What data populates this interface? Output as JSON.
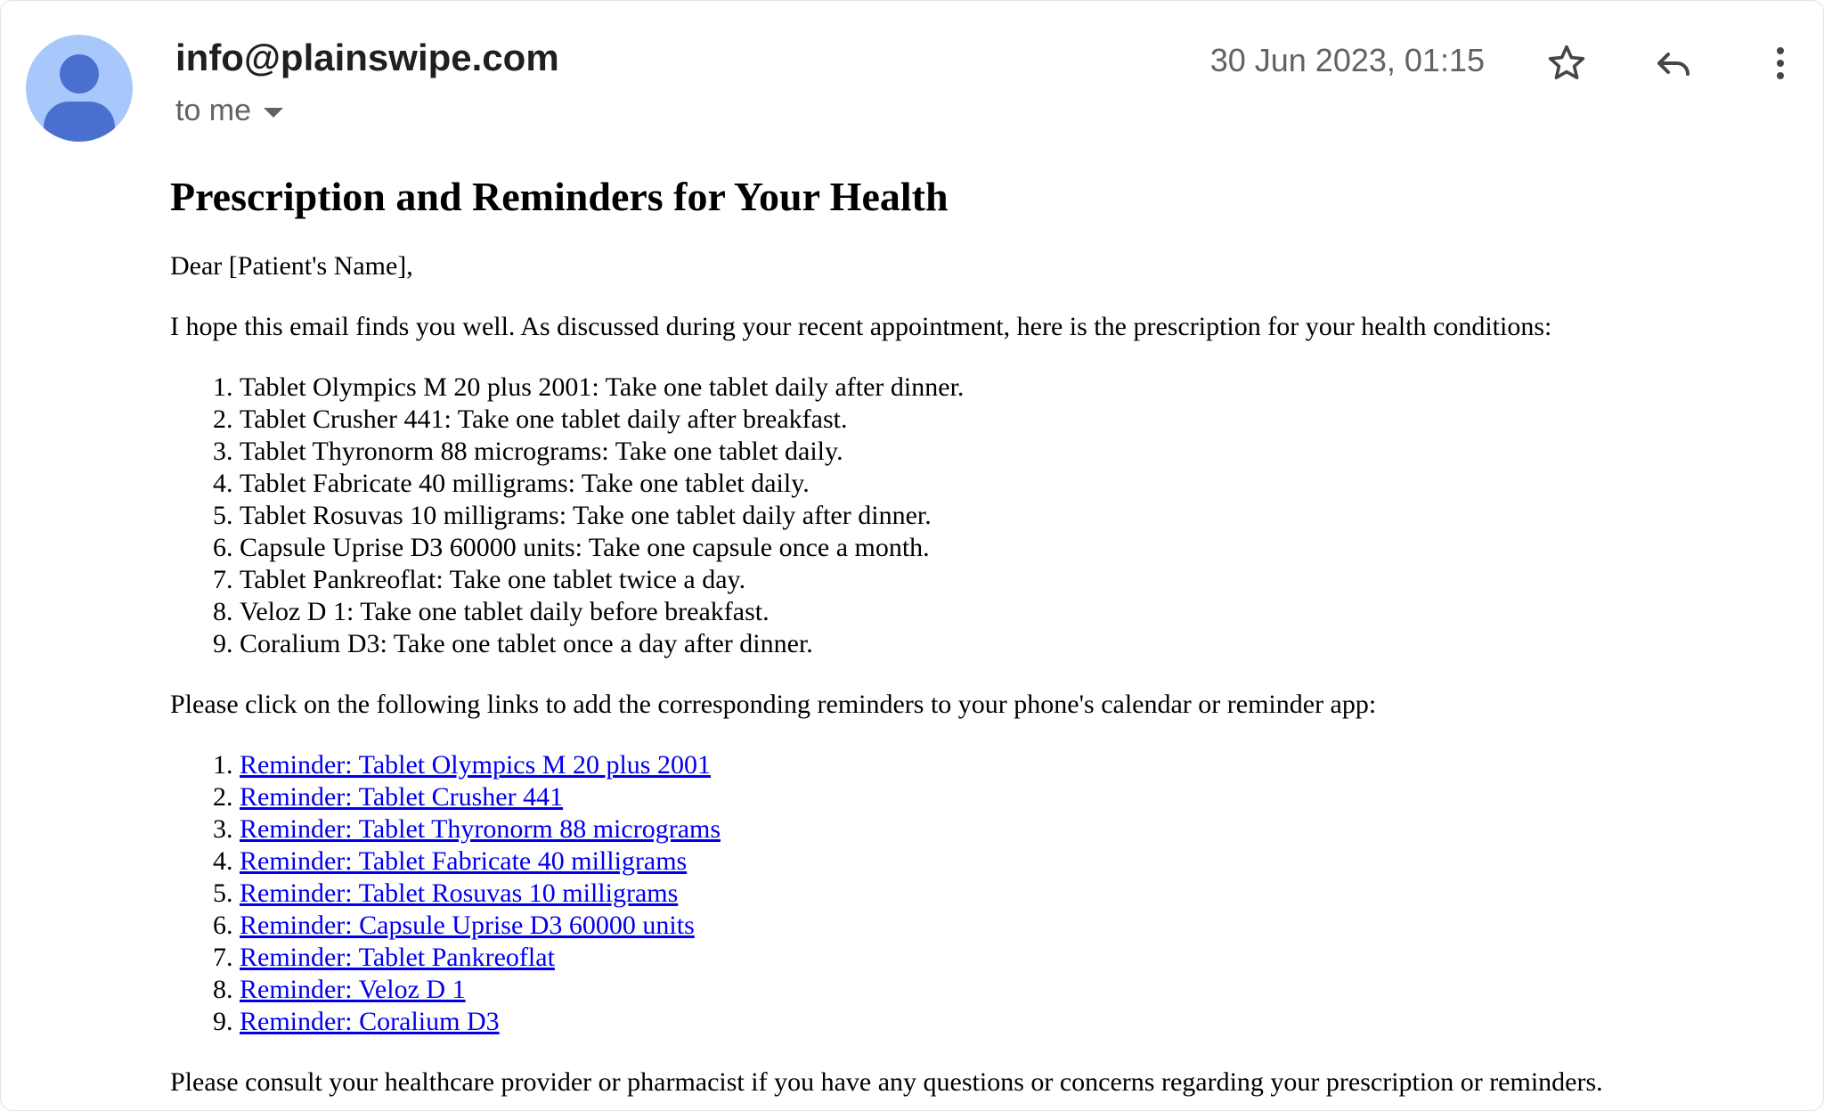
{
  "email": {
    "sender": "info@plainswipe.com",
    "recipient": "to me",
    "date": "30 Jun 2023, 01:15",
    "subject": "Prescription and Reminders for Your Health",
    "greeting": "Dear [Patient's Name],",
    "intro": "I hope this email finds you well. As discussed during your recent appointment, here is the prescription for your health conditions:",
    "prescriptions": [
      "Tablet Olympics M 20 plus 2001: Take one tablet daily after dinner.",
      "Tablet Crusher 441: Take one tablet daily after breakfast.",
      "Tablet Thyronorm 88 micrograms: Take one tablet daily.",
      "Tablet Fabricate 40 milligrams: Take one tablet daily.",
      "Tablet Rosuvas 10 milligrams: Take one tablet daily after dinner.",
      "Capsule Uprise D3 60000 units: Take one capsule once a month.",
      "Tablet Pankreoflat: Take one tablet twice a day.",
      "Veloz D 1: Take one tablet daily before breakfast.",
      "Coralium D3: Take one tablet once a day after dinner."
    ],
    "links_intro": "Please click on the following links to add the corresponding reminders to your phone's calendar or reminder app:",
    "reminders": [
      "Reminder: Tablet Olympics M 20 plus 2001",
      "Reminder: Tablet Crusher 441",
      "Reminder: Tablet Thyronorm 88 micrograms",
      "Reminder: Tablet Fabricate 40 milligrams",
      "Reminder: Tablet Rosuvas 10 milligrams",
      "Reminder: Capsule Uprise D3 60000 units",
      "Reminder: Tablet Pankreoflat",
      "Reminder: Veloz D 1",
      "Reminder: Coralium D3"
    ],
    "closing": "Please consult your healthcare provider or pharmacist if you have any questions or concerns regarding your prescription or reminders."
  },
  "icons": {
    "avatar": "person-avatar-icon",
    "recipient_toggle": "caret-down-icon",
    "star": "star-outline-icon",
    "reply": "reply-arrow-icon",
    "more": "more-vertical-icon"
  },
  "colors": {
    "avatar_bg": "#a8c7fa",
    "avatar_fg": "#4a6fd1",
    "link": "#0000ee",
    "meta_text": "#5f6368"
  }
}
